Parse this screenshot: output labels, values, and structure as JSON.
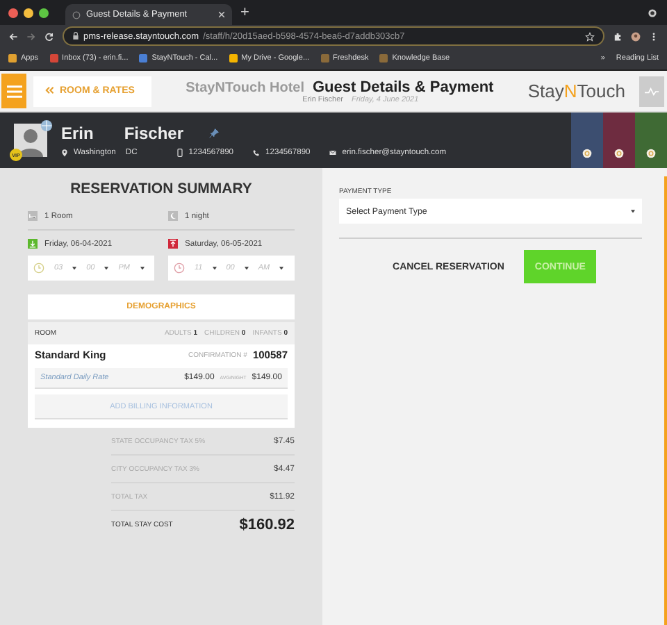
{
  "browser": {
    "tab_title": "Guest Details & Payment",
    "new_tab": "+",
    "url_host": "pms-release.stayntouch.com",
    "url_path": "/staff/h/20d15aed-b598-4574-bea6-d7addb303cb7",
    "bookmarks": [
      {
        "label": "Apps",
        "color": "#e0a030"
      },
      {
        "label": "Inbox (73) - erin.fi...",
        "color": "#d44638"
      },
      {
        "label": "StayNTouch - Cal...",
        "color": "#4a7fd4"
      },
      {
        "label": "My Drive - Google...",
        "color": "#f4b400"
      },
      {
        "label": "Freshdesk",
        "color": "#8a6a3a"
      },
      {
        "label": "Knowledge Base",
        "color": "#8a6a3a"
      }
    ],
    "overflow": "»",
    "reading_list": "Reading List"
  },
  "header": {
    "back_label": "ROOM & RATES",
    "hotel": "StayNTouch Hotel",
    "title": "Guest Details & Payment",
    "guest_name": "Erin Fischer",
    "date": "Friday, 4 June 2021",
    "logo_start": "Stay",
    "logo_mark": "N",
    "logo_end": "Touch"
  },
  "guest": {
    "vip": "VIP",
    "first_name": "Erin",
    "last_name": "Fischer",
    "city": "Washington",
    "state": "DC",
    "mobile": "1234567890",
    "phone": "1234567890",
    "email": "erin.fischer@stayntouch.com",
    "tiles": [
      {
        "color": "#3c4e70"
      },
      {
        "color": "#6e2c40"
      },
      {
        "color": "#3f6a34"
      }
    ]
  },
  "summary": {
    "title": "RESERVATION SUMMARY",
    "rooms": "1 Room",
    "nights": "1 night",
    "arrival": "Friday, 06-04-2021",
    "departure": "Saturday, 06-05-2021",
    "arrival_time": {
      "hour": "03",
      "minute": "00",
      "ampm": "PM"
    },
    "departure_time": {
      "hour": "11",
      "minute": "00",
      "ampm": "AM"
    },
    "demographics": "DEMOGRAPHICS",
    "room": {
      "label": "ROOM",
      "adults_label": "ADULTS",
      "adults": "1",
      "children_label": "CHILDREN",
      "children": "0",
      "infants_label": "INFANTS",
      "infants": "0",
      "type": "Standard King",
      "confirmation_label": "CONFIRMATION #",
      "confirmation": "100587",
      "rate_name": "Standard Daily Rate",
      "rate_amount": "$149.00",
      "avg_label": "AVG/NIGHT",
      "avg_amount": "$149.00",
      "billing": "ADD BILLING INFORMATION"
    },
    "taxes": [
      {
        "kind": "tax",
        "label": "STATE OCCUPANCY TAX 5%",
        "amount": "$7.45"
      },
      {
        "kind": "tax",
        "label": "CITY OCCUPANCY TAX 3%",
        "amount": "$4.47"
      },
      {
        "kind": "tax",
        "label": "TOTAL TAX",
        "amount": "$11.92"
      },
      {
        "kind": "total",
        "label": "TOTAL STAY COST",
        "amount": "$160.92"
      }
    ]
  },
  "payment": {
    "label": "PAYMENT TYPE",
    "select": "Select Payment Type",
    "cancel": "CANCEL RESERVATION",
    "continue": "CONTINUE"
  }
}
